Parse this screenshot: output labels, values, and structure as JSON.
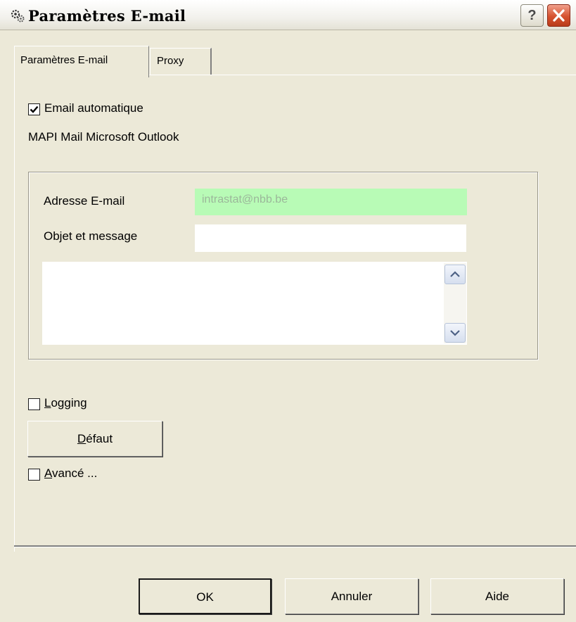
{
  "window": {
    "title": "Paramètres E-mail",
    "help_symbol": "?",
    "app_icon": "settings-gears-icon",
    "close_icon": "close-icon"
  },
  "tabs": [
    {
      "label": "Paramètres E-mail",
      "active": true
    },
    {
      "label": "Proxy",
      "active": false
    }
  ],
  "email_automatic": {
    "label": "Email automatique",
    "checked": true
  },
  "mapi_text": "MAPI Mail Microsoft Outlook",
  "group": {
    "email_label": "Adresse E-mail",
    "email_value": "intrastat@nbb.be",
    "subject_label": "Objet et message",
    "subject_value": "",
    "message_value": ""
  },
  "logging": {
    "label_first": "L",
    "label_rest": "ogging",
    "checked": false
  },
  "default_button": {
    "label_first": "D",
    "label_rest": "éfaut"
  },
  "advanced": {
    "label_first": "A",
    "label_rest": "vancé ...",
    "checked": false
  },
  "footer": {
    "ok": "OK",
    "cancel": "Annuler",
    "help": "Aide"
  },
  "colors": {
    "window_bg": "#ece9d8",
    "email_field_bg": "#b8fbb6",
    "email_text": "#9bb79a",
    "close_button": "#d6522f"
  }
}
